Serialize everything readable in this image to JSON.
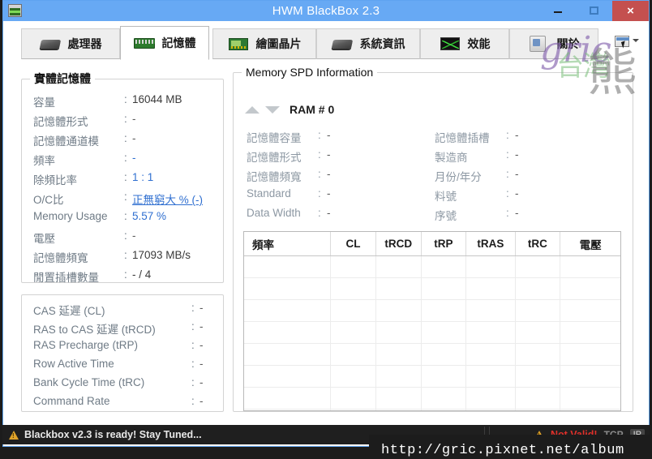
{
  "window": {
    "title": "HWM BlackBox 2.3",
    "icon": "app-icon",
    "minimize": "–",
    "maximize": "□",
    "close": "×"
  },
  "tabs": [
    {
      "label": "處理器",
      "icon": "cpu-icon",
      "active": false
    },
    {
      "label": "記憶體",
      "icon": "ram-icon",
      "active": true
    },
    {
      "label": "繪圖晶片",
      "icon": "gpu-icon",
      "active": false
    },
    {
      "label": "系統資訊",
      "icon": "system-icon",
      "active": false
    },
    {
      "label": "效能",
      "icon": "performance-icon",
      "active": false
    },
    {
      "label": "關於",
      "icon": "about-icon",
      "active": false
    }
  ],
  "export_button": {
    "icon": "export-icon",
    "caret": "chevron-down-icon"
  },
  "physical_memory": {
    "title": "實體記憶體",
    "rows": [
      {
        "label": "容量",
        "sep": ":",
        "value": "16044 MB",
        "style": "normal"
      },
      {
        "label": "記憶體形式",
        "sep": ":",
        "value": "-",
        "style": "dash"
      },
      {
        "label": "記憶體通道模",
        "sep": ":",
        "value": "-",
        "style": "dash"
      },
      {
        "label": "頻率",
        "sep": ":",
        "value": "-",
        "style": "accent"
      },
      {
        "label": "除頻比率",
        "sep": ":",
        "value": "1 : 1",
        "style": "accent"
      },
      {
        "label": "O/C比",
        "sep": ":",
        "value": "正無窮大 % (-)",
        "style": "link"
      },
      {
        "label": "Memory Usage",
        "sep": ":",
        "value": "5.57 %",
        "style": "accent"
      },
      {
        "label": "電壓",
        "sep": ":",
        "value": "-",
        "style": "dash"
      },
      {
        "label": "記憶體頻寬",
        "sep": ":",
        "value": "17093 MB/s",
        "style": "normal"
      },
      {
        "label": "閒置插槽數量",
        "sep": ":",
        "value": "-   /   4",
        "style": "normal"
      }
    ]
  },
  "timings": {
    "rows": [
      {
        "label": "CAS 延遲 (CL)",
        "sep": ":",
        "value": "-"
      },
      {
        "label": "RAS to CAS 延遲 (tRCD)",
        "sep": ":",
        "value": "-"
      },
      {
        "label": "RAS Precharge (tRP)",
        "sep": ":",
        "value": "-"
      },
      {
        "label": "Row Active Time",
        "sep": ":",
        "value": "-"
      },
      {
        "label": "Bank Cycle Time (tRC)",
        "sep": ":",
        "value": "-"
      },
      {
        "label": "Command Rate",
        "sep": ":",
        "value": "-"
      }
    ]
  },
  "spd": {
    "title": "Memory SPD Information",
    "selector": {
      "up_icon": "triangle-up-icon",
      "down_icon": "triangle-down-icon",
      "label": "RAM # 0"
    },
    "left_rows": [
      {
        "label": "記憶體容量",
        "sep": ":",
        "value": "-"
      },
      {
        "label": "記憶體形式",
        "sep": ":",
        "value": "-"
      },
      {
        "label": "記憶體頻寬",
        "sep": ":",
        "value": "-"
      },
      {
        "label": "Standard",
        "sep": ":",
        "value": "-"
      },
      {
        "label": "Data Width",
        "sep": ":",
        "value": "-"
      }
    ],
    "right_rows": [
      {
        "label": "記憶體插槽",
        "sep": ":",
        "value": "-"
      },
      {
        "label": "製造商",
        "sep": ":",
        "value": "-"
      },
      {
        "label": "月份/年分",
        "sep": ":",
        "value": "-"
      },
      {
        "label": "料號",
        "sep": ":",
        "value": "-"
      },
      {
        "label": "序號",
        "sep": ":",
        "value": "-"
      }
    ],
    "table": {
      "columns": [
        "頻率",
        "CL",
        "tRCD",
        "tRP",
        "tRAS",
        "tRC",
        "電壓"
      ],
      "rows": [],
      "empty_row_count": 8
    }
  },
  "statusbar": {
    "warn_icon": "warning-icon",
    "message": "Blackbox v2.3 is ready! Stay Tuned...",
    "warn_icon_right": "warning-icon",
    "invalid_text": "Not Valid!",
    "tcp_label": "TCP",
    "badge": "IP"
  },
  "watermarks": {
    "gric": "gric",
    "taiwan": "台灣",
    "bear": "熊",
    "url": "http://gric.pixnet.net/album"
  },
  "colors": {
    "titlebar": "#67a9f4",
    "close_button": "#c4504f",
    "accent_value": "#2f6fd0",
    "label_text": "#6f7b86",
    "status_bar": "#1f1f1f",
    "invalid_red": "#e0302a"
  }
}
